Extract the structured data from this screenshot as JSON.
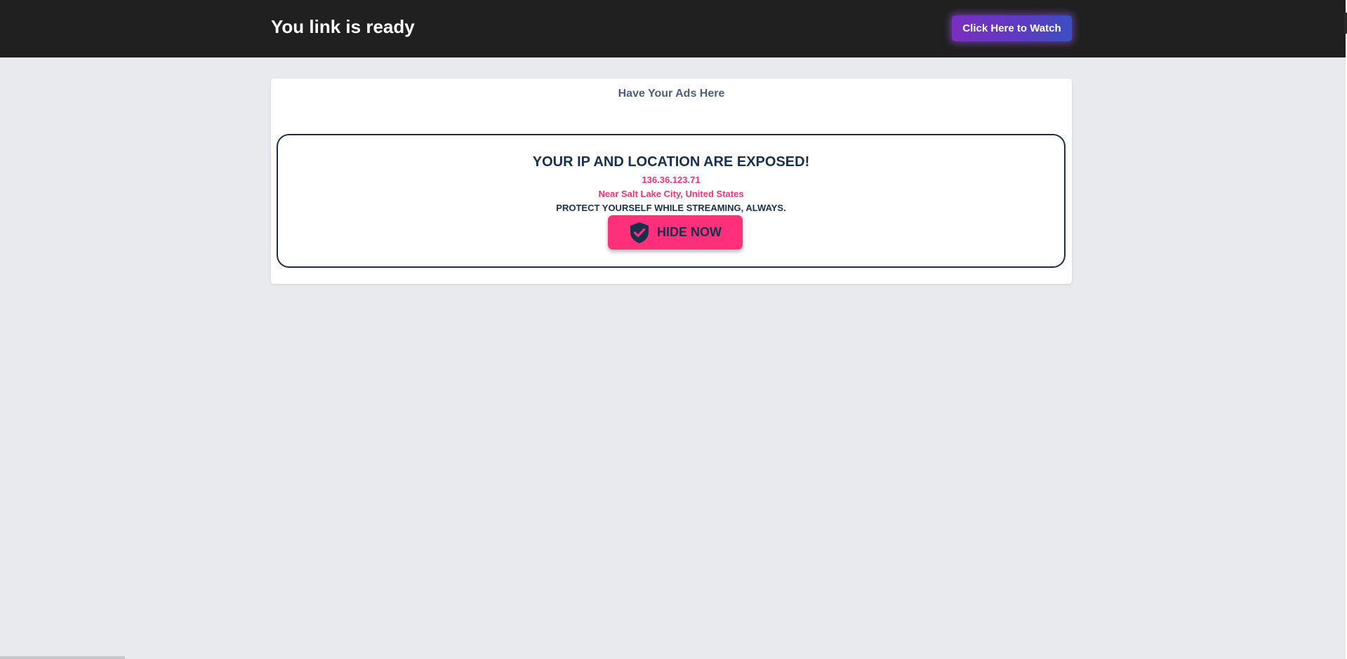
{
  "header": {
    "title": "You link is ready",
    "watch_button_label": "Click Here to Watch"
  },
  "ad_card": {
    "label": "Have Your Ads Here"
  },
  "alert": {
    "headline": "YOUR IP AND LOCATION ARE EXPOSED!",
    "ip": "136.36.123.71",
    "location": "Near Salt Lake City, United States",
    "message": "PROTECT YOURSELF WHILE STREAMING, ALWAYS.",
    "button_label": "HIDE NOW",
    "button_icon": "shield-check-icon"
  },
  "colors": {
    "header_bg": "#202020",
    "page_bg": "#e8eaee",
    "navy": "#16304d",
    "pink": "#ff2f7a",
    "purple_gradient_start": "#7a2fc0",
    "purple_gradient_end": "#3b4fc0"
  }
}
